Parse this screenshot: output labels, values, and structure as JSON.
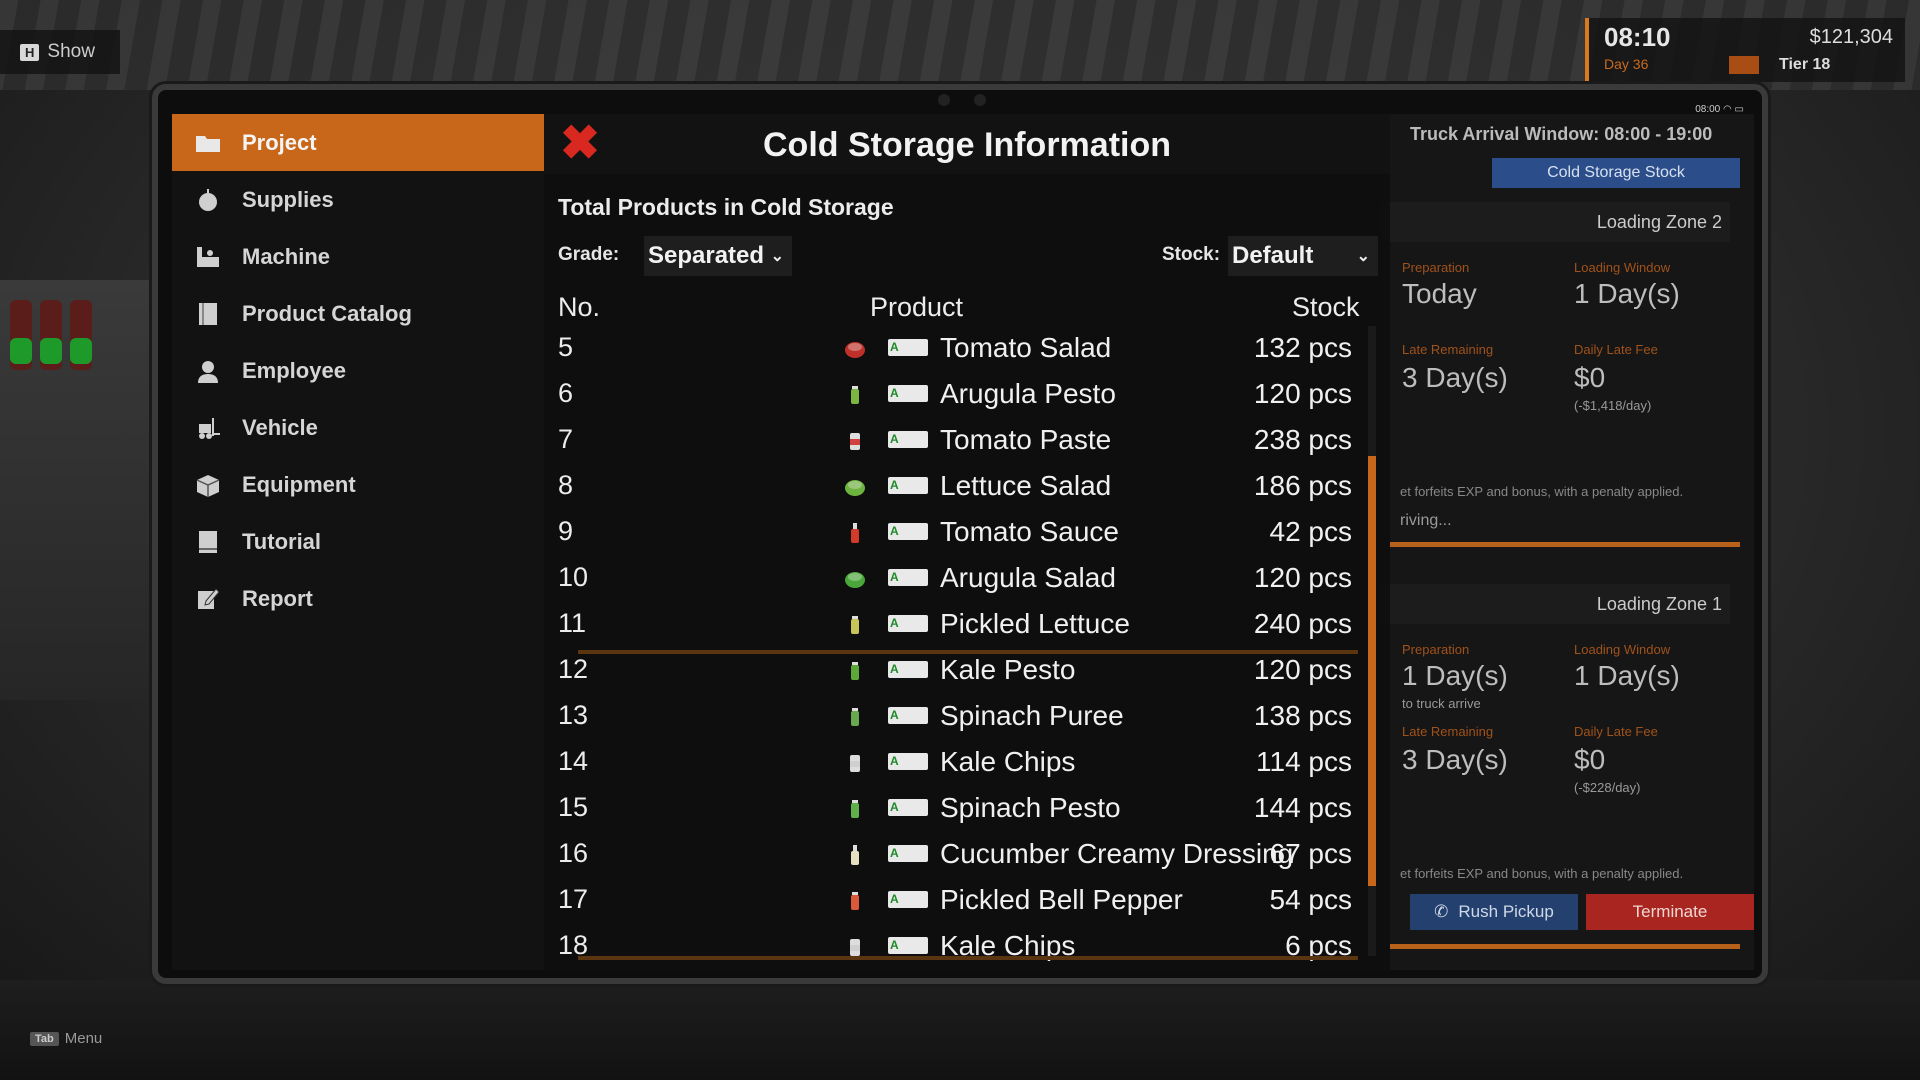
{
  "top_left": {
    "key": "H",
    "label": "Show"
  },
  "hud": {
    "time": "08:10",
    "day": "Day 36",
    "money": "$121,304",
    "tier": "Tier 18"
  },
  "tablet_status": {
    "clock": "08:00"
  },
  "sidebar": {
    "items": [
      {
        "label": "Project",
        "icon": "folder-icon",
        "active": true
      },
      {
        "label": "Supplies",
        "icon": "apple-icon",
        "active": false
      },
      {
        "label": "Machine",
        "icon": "machine-icon",
        "active": false
      },
      {
        "label": "Product Catalog",
        "icon": "catalog-icon",
        "active": false
      },
      {
        "label": "Employee",
        "icon": "person-icon",
        "active": false
      },
      {
        "label": "Vehicle",
        "icon": "forklift-icon",
        "active": false
      },
      {
        "label": "Equipment",
        "icon": "box-icon",
        "active": false
      },
      {
        "label": "Tutorial",
        "icon": "book-icon",
        "active": false
      },
      {
        "label": "Report",
        "icon": "report-icon",
        "active": false
      }
    ]
  },
  "right_panel": {
    "truck_window": "Truck Arrival Window: 08:00 - 19:00",
    "tab": "Cold Storage Stock",
    "zone2": {
      "title": "Loading Zone 2",
      "prep_label": "Preparation",
      "prep_value": "Today",
      "window_label": "Loading Window",
      "window_value": "1 Day(s)",
      "late_label": "Late Remaining",
      "late_value": "3 Day(s)",
      "fee_label": "Daily Late Fee",
      "fee_value": "$0",
      "fee_sub": "(-$1,418/day)",
      "note": "et forfeits EXP and bonus, with a penalty applied.",
      "status": "riving..."
    },
    "zone1": {
      "title": "Loading Zone 1",
      "prep_label": "Preparation",
      "prep_value": "1 Day(s)",
      "prep_sub": "to truck arrive",
      "window_label": "Loading Window",
      "window_value": "1 Day(s)",
      "late_label": "Late Remaining",
      "late_value": "3 Day(s)",
      "fee_label": "Daily Late Fee",
      "fee_value": "$0",
      "fee_sub": "(-$228/day)",
      "note": "et forfeits EXP and bonus, with a penalty applied.",
      "rush_label": "Rush Pickup",
      "terminate_label": "Terminate"
    }
  },
  "modal": {
    "title": "Cold Storage Information",
    "subtitle": "Total Products in Cold Storage",
    "grade_label": "Grade:",
    "grade_value": "Separated",
    "stock_label": "Stock:",
    "stock_value": "Default",
    "columns": {
      "no": "No.",
      "product": "Product",
      "stock": "Stock"
    },
    "grade_badge": "A",
    "rows": [
      {
        "no": "5",
        "product": "Tomato Salad",
        "stock": "132 pcs",
        "icon": "tomato-salad-icon",
        "color": "#c0302a"
      },
      {
        "no": "6",
        "product": "Arugula Pesto",
        "stock": "120 pcs",
        "icon": "jar-icon",
        "color": "#7ab640"
      },
      {
        "no": "7",
        "product": "Tomato Paste",
        "stock": "238 pcs",
        "icon": "can-icon",
        "color": "#d04040"
      },
      {
        "no": "8",
        "product": "Lettuce Salad",
        "stock": "186 pcs",
        "icon": "salad-bowl-icon",
        "color": "#6db33f"
      },
      {
        "no": "9",
        "product": "Tomato Sauce",
        "stock": "42 pcs",
        "icon": "bottle-icon",
        "color": "#d23a2a"
      },
      {
        "no": "10",
        "product": "Arugula Salad",
        "stock": "120 pcs",
        "icon": "salad-bowl-icon",
        "color": "#4aa83a"
      },
      {
        "no": "11",
        "product": "Pickled Lettuce",
        "stock": "240 pcs",
        "icon": "jar-icon",
        "color": "#c8c45a"
      },
      {
        "no": "12",
        "product": "Kale Pesto",
        "stock": "120 pcs",
        "icon": "jar-icon",
        "color": "#5ea83a"
      },
      {
        "no": "13",
        "product": "Spinach Puree",
        "stock": "138 pcs",
        "icon": "jar-icon",
        "color": "#6aa850"
      },
      {
        "no": "14",
        "product": "Kale Chips",
        "stock": "114 pcs",
        "icon": "bag-icon",
        "color": "#cfcfcf"
      },
      {
        "no": "15",
        "product": "Spinach Pesto",
        "stock": "144 pcs",
        "icon": "jar-icon",
        "color": "#5fb04a"
      },
      {
        "no": "16",
        "product": "Cucumber Creamy Dressing",
        "stock": "67 pcs",
        "icon": "bottle-icon",
        "color": "#e6e0c0"
      },
      {
        "no": "17",
        "product": "Pickled Bell Pepper",
        "stock": "54 pcs",
        "icon": "jar-icon",
        "color": "#d85a3a"
      },
      {
        "no": "18",
        "product": "Kale Chips",
        "stock": "6 pcs",
        "icon": "bag-icon",
        "color": "#cfcfcf"
      }
    ]
  },
  "footer": {
    "key": "Tab",
    "label": "Menu"
  }
}
